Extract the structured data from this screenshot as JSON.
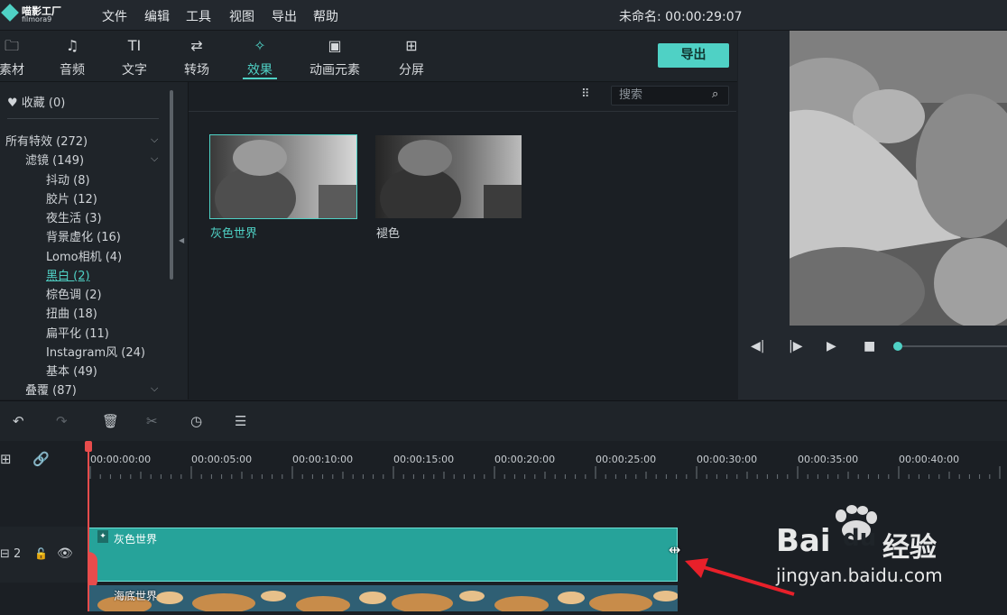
{
  "app": {
    "logo_text": "喵影工厂",
    "logo_sub": "filmora9",
    "doc_title": "未命名: 00:00:29:07"
  },
  "menu": [
    "文件",
    "编辑",
    "工具",
    "视图",
    "导出",
    "帮助"
  ],
  "toolbar": {
    "tabs": [
      {
        "label": "素材",
        "icon": "folder-icon"
      },
      {
        "label": "音频",
        "icon": "music-note-icon"
      },
      {
        "label": "文字",
        "icon": "text-icon"
      },
      {
        "label": "转场",
        "icon": "transition-icon"
      },
      {
        "label": "效果",
        "icon": "effects-icon"
      },
      {
        "label": "动画元素",
        "icon": "image-icon"
      },
      {
        "label": "分屏",
        "icon": "split-screen-icon"
      }
    ],
    "active_tab": "效果",
    "export_label": "导出"
  },
  "sidebar": {
    "favorites": "收藏 (0)",
    "items": [
      {
        "label": "所有特效 (272)",
        "level": 0,
        "expanded": true
      },
      {
        "label": "滤镜 (149)",
        "level": 1,
        "expanded": true
      },
      {
        "label": "抖动 (8)",
        "level": 2
      },
      {
        "label": "胶片 (12)",
        "level": 2
      },
      {
        "label": "夜生活 (3)",
        "level": 2
      },
      {
        "label": "背景虚化 (16)",
        "level": 2
      },
      {
        "label": "Lomo相机 (4)",
        "level": 2
      },
      {
        "label": "黑白 (2)",
        "level": 2,
        "selected": true
      },
      {
        "label": "棕色调 (2)",
        "level": 2
      },
      {
        "label": "扭曲 (18)",
        "level": 2
      },
      {
        "label": "扁平化 (11)",
        "level": 2
      },
      {
        "label": "Instagram风 (24)",
        "level": 2
      },
      {
        "label": "基本 (49)",
        "level": 2
      },
      {
        "label": "叠覆 (87)",
        "level": 1,
        "expanded": false
      }
    ]
  },
  "effects_grid": {
    "search_placeholder": "搜索",
    "items": [
      {
        "label": "灰色世界",
        "selected": true
      },
      {
        "label": "褪色",
        "selected": false
      }
    ]
  },
  "timeline": {
    "ticks": [
      "00:00:00:00",
      "00:00:05:00",
      "00:00:10:00",
      "00:00:15:00",
      "00:00:20:00",
      "00:00:25:00",
      "00:00:30:00",
      "00:00:35:00",
      "00:00:40:00"
    ],
    "track_number": "2",
    "effect_clip_label": "灰色世界",
    "video_clip_label": "海底世界"
  },
  "watermark": {
    "brand": "Bai",
    "brand2": "du",
    "cn": "经验",
    "url": "jingyan.baidu.com"
  },
  "colors": {
    "accent": "#4fd1c5",
    "clip": "#26a39a",
    "playhead": "#e84c4c",
    "arrow": "#e8202a"
  }
}
